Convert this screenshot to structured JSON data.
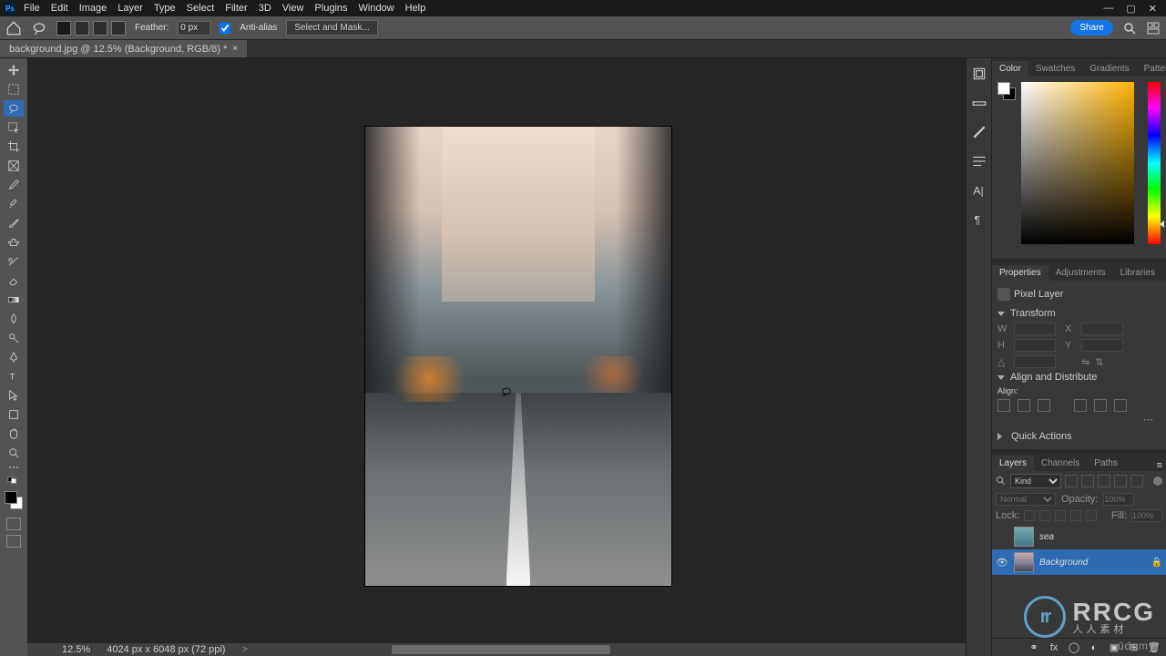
{
  "menu": {
    "file": "File",
    "edit": "Edit",
    "image": "Image",
    "layer": "Layer",
    "type": "Type",
    "select": "Select",
    "filter": "Filter",
    "threeD": "3D",
    "view": "View",
    "plugins": "Plugins",
    "window": "Window",
    "help": "Help"
  },
  "options": {
    "feather_label": "Feather:",
    "feather_value": "0 px",
    "antialias_label": "Anti-alias",
    "select_mask": "Select and Mask...",
    "share": "Share"
  },
  "doc_tab": {
    "title": "background.jpg @ 12.5% (Background, RGB/8) *"
  },
  "status": {
    "zoom": "12.5%",
    "dims": "4024 px x 6048 px (72 ppi)",
    "arrow": ">"
  },
  "color_tabs": {
    "color": "Color",
    "swatches": "Swatches",
    "gradients": "Gradients",
    "patterns": "Patterns"
  },
  "props_tabs": {
    "properties": "Properties",
    "adjustments": "Adjustments",
    "libraries": "Libraries"
  },
  "props": {
    "pixel_layer": "Pixel Layer",
    "transform": "Transform",
    "w_label": "W",
    "h_label": "H",
    "x_label": "X",
    "y_label": "Y",
    "angle_label": "△",
    "align_dist": "Align and Distribute",
    "align_label": "Align:",
    "quick_actions": "Quick Actions"
  },
  "layers_tabs": {
    "layers": "Layers",
    "channels": "Channels",
    "paths": "Paths"
  },
  "layers": {
    "kind": "Kind",
    "blend": "Normal",
    "opacity_label": "Opacity:",
    "opacity_value": "100%",
    "lock_label": "Lock:",
    "fill_label": "Fill:",
    "fill_value": "100%",
    "items": [
      {
        "name": "sea",
        "visible": false,
        "locked": false
      },
      {
        "name": "Background",
        "visible": true,
        "locked": true
      }
    ]
  },
  "watermark": {
    "brand": "RRCG",
    "sub": "人人素材",
    "corner": "ûdemy"
  }
}
